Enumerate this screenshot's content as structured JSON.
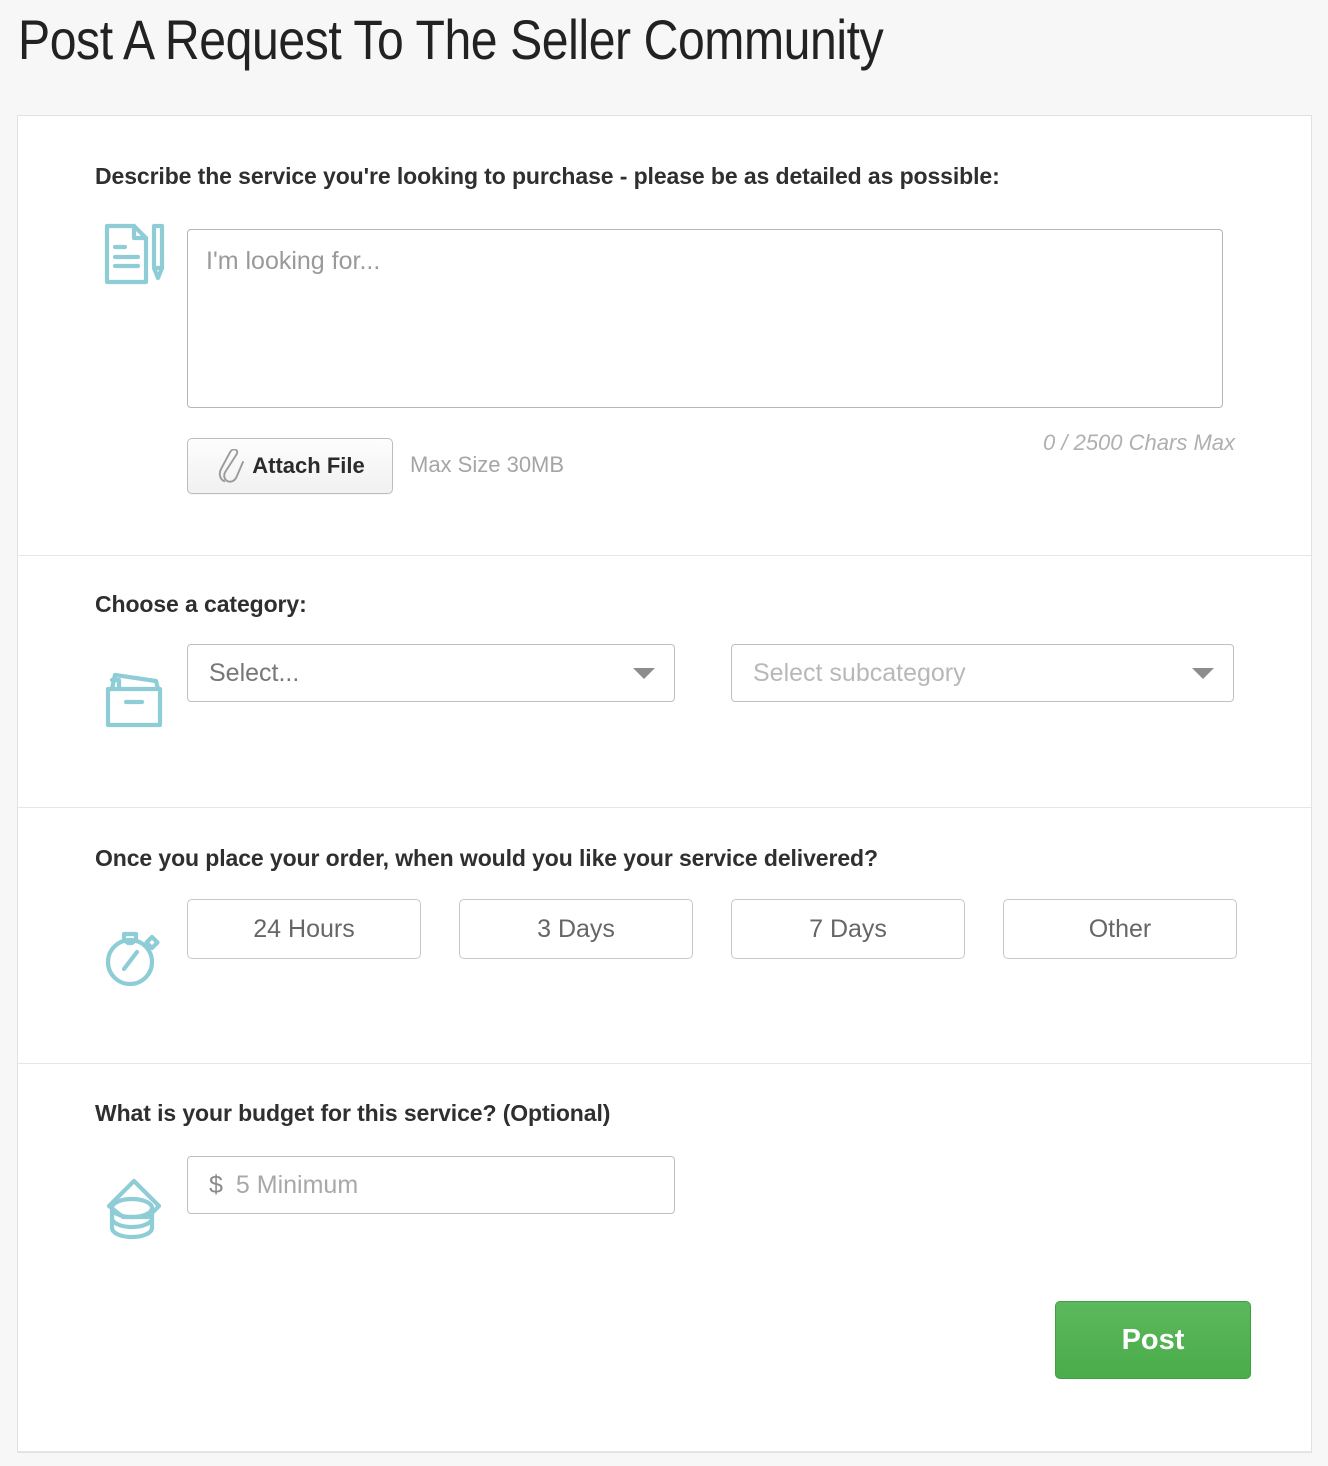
{
  "page": {
    "title": "Post A Request To The Seller Community",
    "accent_teal": "#8ecdd6",
    "post_green": "#5cb85c",
    "card_bg": "#ffffff",
    "page_bg": "#f7f7f7"
  },
  "describe": {
    "label": "Describe the service you're looking to purchase - please be as detailed as possible:",
    "icon": "document-pencil-icon",
    "textarea_placeholder": "I'm looking for...",
    "textarea_value": "",
    "attach_label": "Attach File",
    "attach_icon": "paperclip-icon",
    "max_size": "Max Size 30MB",
    "char_count": "0 / 2500 Chars Max"
  },
  "category": {
    "label": "Choose a category:",
    "icon": "file-box-icon",
    "primary_select_value": "Select...",
    "subcategory_select_value": "Select subcategory",
    "caret_icon": "chevron-down-icon"
  },
  "delivery": {
    "label": "Once you place your order, when would you like your service delivered?",
    "icon": "stopwatch-icon",
    "options": [
      {
        "label": "24 Hours"
      },
      {
        "label": "3 Days"
      },
      {
        "label": "7 Days"
      },
      {
        "label": "Other"
      }
    ]
  },
  "budget": {
    "label": "What is your budget for this service? (Optional)",
    "icon": "coins-icon",
    "currency_symbol": "$",
    "input_placeholder": "5 Minimum",
    "input_value": ""
  },
  "footer": {
    "post_label": "Post"
  }
}
